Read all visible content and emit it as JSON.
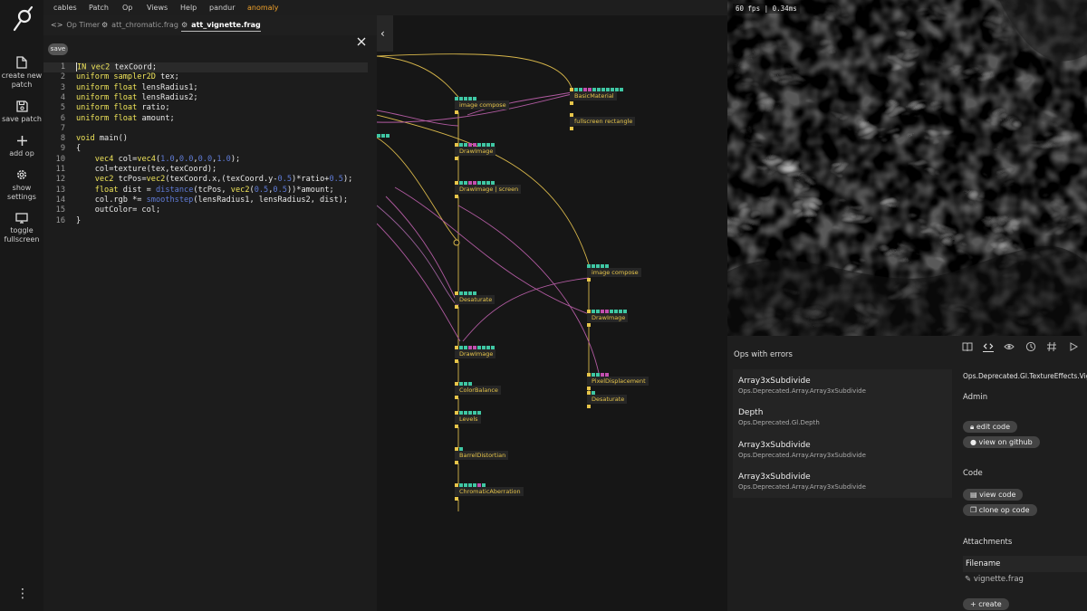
{
  "sidebar": {
    "create_label": "create new patch",
    "save_label": "save patch",
    "addop_label": "add op",
    "settings_label": "show settings",
    "fullscreen_label": "toggle fullscreen"
  },
  "menu": {
    "items": [
      "cables",
      "Patch",
      "Op",
      "Views",
      "Help",
      "pandur"
    ],
    "accent_item": "anomaly",
    "accent_color": "#f0a22b"
  },
  "editor": {
    "tabs": [
      {
        "icon": "<>",
        "label": "Op Timer"
      },
      {
        "icon": "⚙",
        "label": "att_chromatic.frag"
      },
      {
        "icon": "⚙",
        "label": "att_vignette.frag"
      }
    ],
    "active_tab": 2,
    "save_label": "save",
    "lines": [
      {
        "n": "1",
        "html": "<span class=\"cursor\"></span><span class=\"kw\">IN</span> <span class=\"kw\">vec2</span> texCoord;"
      },
      {
        "n": "2",
        "html": "<span class=\"kw\">uniform</span> <span class=\"kw\">sampler2D</span> tex;"
      },
      {
        "n": "3",
        "html": "<span class=\"kw\">uniform</span> <span class=\"kw\">float</span> lensRadius1;"
      },
      {
        "n": "4",
        "html": "<span class=\"kw\">uniform</span> <span class=\"kw\">float</span> lensRadius2;"
      },
      {
        "n": "5",
        "html": "<span class=\"kw\">uniform</span> <span class=\"kw\">float</span> ratio;"
      },
      {
        "n": "6",
        "html": "<span class=\"kw\">uniform</span> <span class=\"kw\">float</span> amount;"
      },
      {
        "n": "7",
        "html": ""
      },
      {
        "n": "8",
        "html": "<span class=\"kw\">void</span> main()"
      },
      {
        "n": "9",
        "html": "{"
      },
      {
        "n": "10",
        "html": "    <span class=\"kw\">vec4</span> col=<span class=\"kw\">vec4</span>(<span class=\"num\">1.0</span>,<span class=\"num\">0.0</span>,<span class=\"num\">0.0</span>,<span class=\"num\">1.0</span>);"
      },
      {
        "n": "11",
        "html": "    col=texture(tex,texCoord);"
      },
      {
        "n": "12",
        "html": "    <span class=\"kw\">vec2</span> tcPos=<span class=\"kw\">vec2</span>(texCoord.x,(texCoord.y-<span class=\"num\">0.5</span>)*ratio+<span class=\"num\">0.5</span>);"
      },
      {
        "n": "13",
        "html": "    <span class=\"kw\">float</span> dist = <span class=\"fn\">distance</span>(tcPos, <span class=\"kw\">vec2</span>(<span class=\"num\">0.5</span>,<span class=\"num\">0.5</span>))*amount;"
      },
      {
        "n": "14",
        "html": "    col.rgb *= <span class=\"fn\">smoothstep</span>(lensRadius1, lensRadius2, dist);"
      },
      {
        "n": "15",
        "html": "    outColor= col;"
      },
      {
        "n": "16",
        "html": "}"
      }
    ]
  },
  "patch": {
    "ops": [
      {
        "label": "image compose",
        "ports": "ggggg"
      },
      {
        "label": "BasicMaterial",
        "ports": "yggmmggggggg"
      },
      {
        "label": "fullscreen rectangle",
        "ports": "y"
      },
      {
        "label": "DrawImage",
        "ports": "yggmmgggg"
      },
      {
        "label": "DrawImage | screen",
        "ports": "yggmmgggg"
      },
      {
        "label": "image compose",
        "ports": "ggggg"
      },
      {
        "label": "DrawImage",
        "ports": "yggmmgggg"
      },
      {
        "label": "Desaturate",
        "ports": "ygggg"
      },
      {
        "label": "DrawImage",
        "ports": "yggmmgggg"
      },
      {
        "label": "PixelDisplacement",
        "ports": "yggmm"
      },
      {
        "label": "Desaturate",
        "ports": "yg"
      },
      {
        "label": "ColorBalance",
        "ports": "yggg"
      },
      {
        "label": "Levels",
        "ports": "yggggg"
      },
      {
        "label": "BarrelDistortian",
        "ports": "yg"
      },
      {
        "label": "ChromaticAberration",
        "ports": "yggggmg"
      }
    ]
  },
  "canvas": {
    "fps_text": "60 fps | 0.34ms"
  },
  "errors": {
    "title": "Ops with errors",
    "items": [
      {
        "name": "Array3xSubdivide",
        "path": "Ops.Deprecated.Array.Array3xSubdivide"
      },
      {
        "name": "Depth",
        "path": "Ops.Deprecated.Gl.Depth"
      },
      {
        "name": "Array3xSubdivide",
        "path": "Ops.Deprecated.Array.Array3xSubdivide"
      },
      {
        "name": "Array3xSubdivide",
        "path": "Ops.Deprecated.Array.Array3xSubdivide"
      }
    ]
  },
  "opinfo": {
    "op_name": "Ops.Deprecated.Gl.TextureEffects.Vignette",
    "admin_title": "Admin",
    "edit_code": "edit code",
    "view_github": "view on github",
    "code_title": "Code",
    "view_code": "view code",
    "clone_code": "clone op code",
    "attachments_title": "Attachments",
    "filename_header": "Filename",
    "filename": "vignette.frag",
    "create_label": "create"
  }
}
